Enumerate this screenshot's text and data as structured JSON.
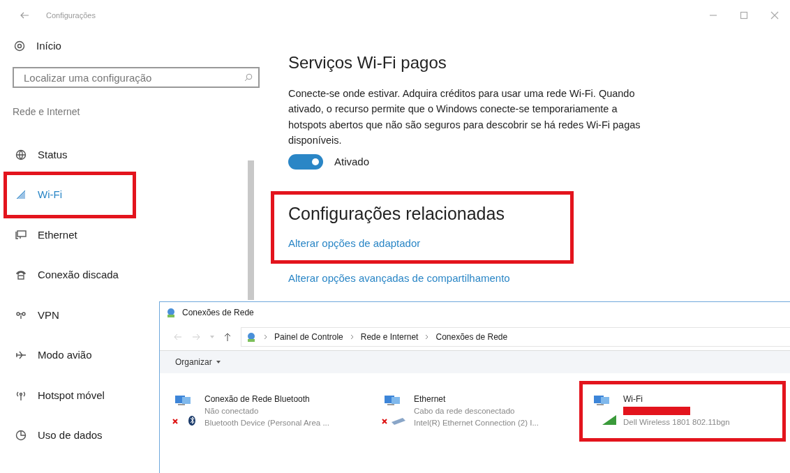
{
  "window": {
    "title": "Configurações"
  },
  "sidebar": {
    "home": "Início",
    "search": {
      "placeholder": "Localizar uma configuração"
    },
    "section": "Rede e Internet",
    "items": [
      {
        "label": "Status",
        "selected": false,
        "highlight": false
      },
      {
        "label": "Wi-Fi",
        "selected": true,
        "highlight": true
      },
      {
        "label": "Ethernet",
        "selected": false,
        "highlight": false
      },
      {
        "label": "Conexão discada",
        "selected": false,
        "highlight": false
      },
      {
        "label": "VPN",
        "selected": false,
        "highlight": false
      },
      {
        "label": "Modo avião",
        "selected": false,
        "highlight": false
      },
      {
        "label": "Hotspot móvel",
        "selected": false,
        "highlight": false
      },
      {
        "label": "Uso de dados",
        "selected": false,
        "highlight": false
      }
    ]
  },
  "main": {
    "title": "Serviços Wi-Fi pagos",
    "description": "Conecte-se onde estivar. Adquira créditos para usar uma rede Wi-Fi. Quando ativado, o recurso permite que o Windows conecte-se temporariamente a hotspots abertos que não são seguros para descobrir se há redes Wi-Fi pagas disponíveis.",
    "toggle": {
      "on": true,
      "label": "Ativado"
    },
    "related": {
      "title": "Configurações relacionadas",
      "highlight": true,
      "links": [
        "Alterar opções de adaptador",
        "Alterar opções avançadas de compartilhamento"
      ]
    }
  },
  "explorer": {
    "title": "Conexões de Rede",
    "breadcrumbs": [
      "Painel de Controle",
      "Rede e Internet",
      "Conexões de Rede"
    ],
    "toolbar": "Organizar",
    "items": [
      {
        "kind": "bluetooth",
        "name": "Conexão de Rede Bluetooth",
        "status": "Não conectado",
        "device": "Bluetooth Device (Personal Area ...",
        "redacted": false,
        "highlight": false
      },
      {
        "kind": "ethernet",
        "name": "Ethernet",
        "status": "Cabo da rede desconectado",
        "device": "Intel(R) Ethernet Connection (2) I...",
        "redacted": false,
        "highlight": false
      },
      {
        "kind": "wifi",
        "name": "Wi-Fi",
        "device": "Dell Wireless 1801 802.11bgn",
        "redacted": true,
        "highlight": true
      }
    ]
  }
}
